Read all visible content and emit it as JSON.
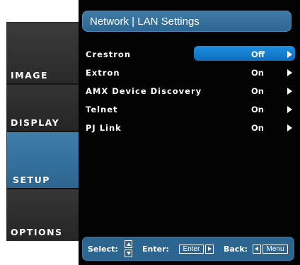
{
  "sidebar": {
    "tabs": [
      {
        "label": "IMAGE"
      },
      {
        "label": "DISPLAY"
      },
      {
        "label": "SETUP",
        "active": true
      },
      {
        "label": "OPTIONS"
      }
    ]
  },
  "header": {
    "title": "Network | LAN Settings"
  },
  "settings": [
    {
      "label": "Crestron",
      "value": "Off",
      "selected": true
    },
    {
      "label": "Extron",
      "value": "On"
    },
    {
      "label": "AMX Device Discovery",
      "value": "On"
    },
    {
      "label": "Telnet",
      "value": "On"
    },
    {
      "label": "PJ Link",
      "value": "On"
    }
  ],
  "footer": {
    "select_label": "Select:",
    "enter_label": "Enter:",
    "enter_key": "Enter",
    "back_label": "Back:",
    "menu_key": "Menu"
  },
  "colors": {
    "accent": "#2d6791",
    "highlight": "#1683d6",
    "background": "#030303"
  },
  "icons": {
    "row_arrow": "triangle-right",
    "select_keys": "up-down-arrows",
    "back_key": "triangle-left"
  }
}
